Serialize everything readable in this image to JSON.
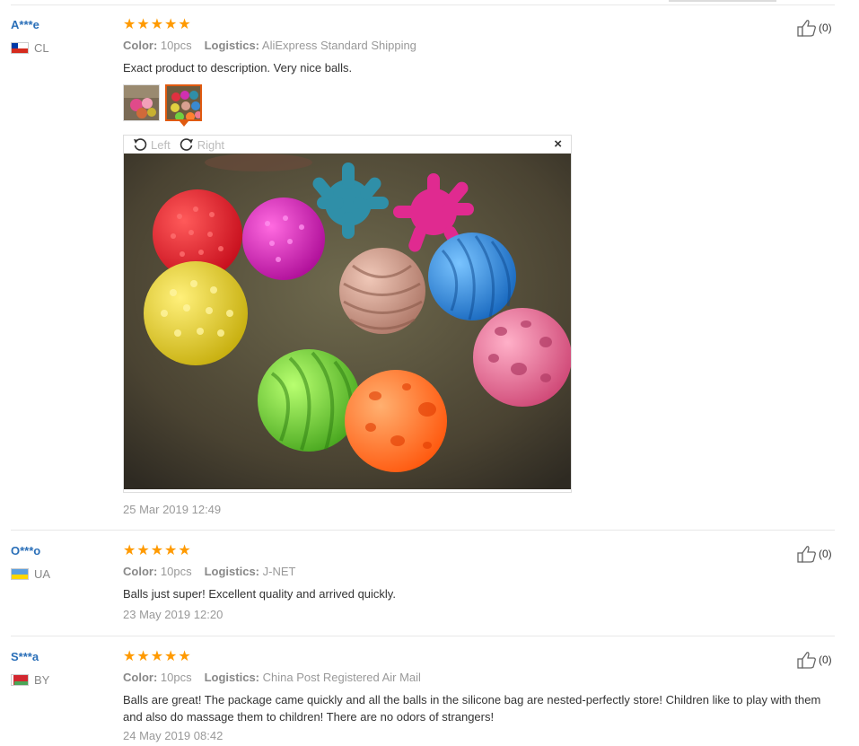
{
  "reviews": [
    {
      "user": "A***e",
      "country": "CL",
      "stars": 5,
      "color_label": "Color:",
      "color_value": "10pcs",
      "logistics_label": "Logistics:",
      "logistics_value": "AliExpress Standard Shipping",
      "text": "Exact product to description. Very nice balls.",
      "date": "25 Mar 2019 12:49",
      "helpful": "(0)"
    },
    {
      "user": "O***o",
      "country": "UA",
      "stars": 5,
      "color_label": "Color:",
      "color_value": "10pcs",
      "logistics_label": "Logistics:",
      "logistics_value": "J-NET",
      "text": "Balls just super! Excellent quality and arrived quickly.",
      "date": "23 May 2019 12:20",
      "helpful": "(0)"
    },
    {
      "user": "S***a",
      "country": "BY",
      "stars": 5,
      "color_label": "Color:",
      "color_value": "10pcs",
      "logistics_label": "Logistics:",
      "logistics_value": "China Post Registered Air Mail",
      "text": "Balls are great! The package came quickly and all the balls in the silicone bag are nested-perfectly store! Children like to play with them and also do massage them to children! There are no odors of strangers!",
      "date": "24 May 2019 08:42",
      "helpful": "(0)"
    }
  ],
  "viewer": {
    "rotate_left": "Left",
    "rotate_right": "Right",
    "close": "×"
  },
  "star_glyph": "★",
  "colors": {
    "star": "#ff9a00",
    "username": "#2a6fb8",
    "active_thumb_border": "#e05a10"
  }
}
